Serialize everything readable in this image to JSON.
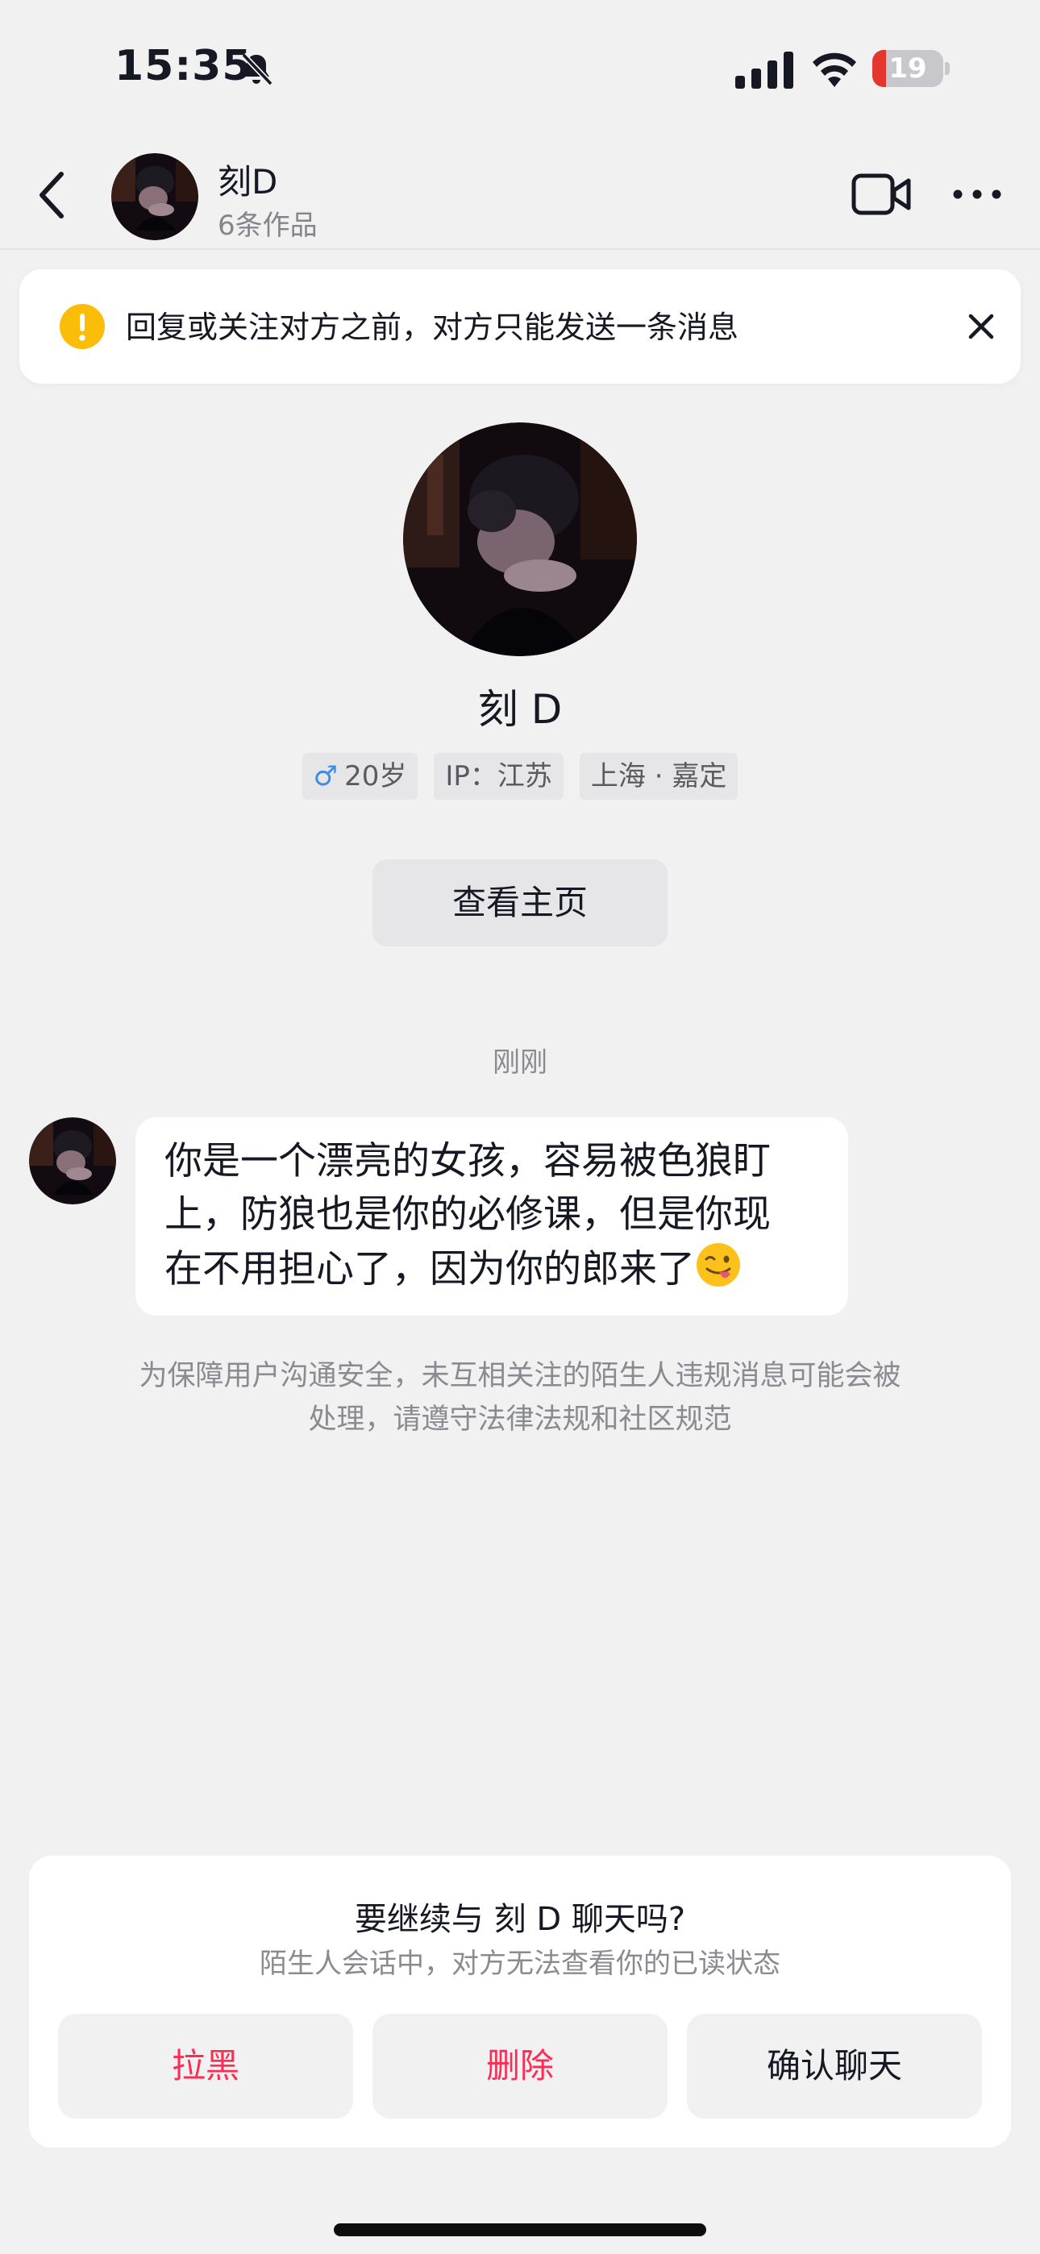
{
  "status_bar": {
    "time": "15:35",
    "battery_level": "19",
    "battery_fraction": 0.19,
    "icons": [
      "bell-slash-icon",
      "signal-icon",
      "wifi-icon",
      "battery-icon"
    ]
  },
  "header": {
    "name": "刻D",
    "works": "6条作品",
    "icons": [
      "chevron-left-icon",
      "video-camera-icon",
      "more-dots-icon"
    ]
  },
  "banner": {
    "text": "回复或关注对方之前，对方只能发送一条消息",
    "icons": [
      "warning-icon",
      "close-icon"
    ]
  },
  "profile": {
    "name": "刻 D",
    "gender_symbol": "♂",
    "age": "20岁",
    "ip": "IP：江苏",
    "location": "上海 · 嘉定",
    "view_home_label": "查看主页"
  },
  "chat": {
    "timestamp": "刚刚",
    "message_lines": [
      "你是一个漂亮的女孩，容易被色狼盯",
      "上，防狼也是你的必修课，但是你现",
      "在不用担心了，因为你的郎来了"
    ],
    "message_emoji": "winking-tongue-emoji",
    "notice_lines": [
      "为保障用户沟通安全，未互相关注的陌生人违规消息可能会被",
      "处理，请遵守法律法规和社区规范"
    ]
  },
  "prompt": {
    "title": "要继续与 刻 D 聊天吗?",
    "subtitle": "陌生人会话中，对方无法查看你的已读状态",
    "block_label": "拉黑",
    "delete_label": "删除",
    "confirm_label": "确认聊天"
  },
  "colors": {
    "background": "#f1f1f2",
    "accent_red": "#fe2c55",
    "warning_yellow": "#fbbd08",
    "male_blue": "#3a8ee6",
    "battery_red": "#e5352f"
  }
}
